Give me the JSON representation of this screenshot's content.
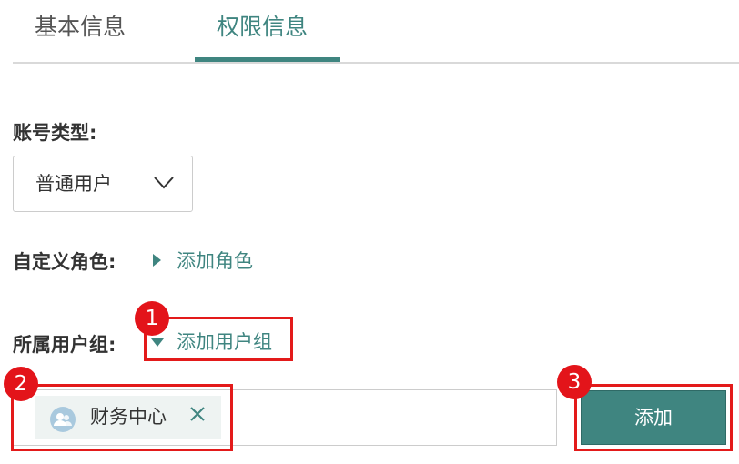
{
  "tabs": [
    {
      "label": "基本信息",
      "active": false
    },
    {
      "label": "权限信息",
      "active": true
    }
  ],
  "account_type": {
    "label": "账号类型:",
    "selected": "普通用户"
  },
  "custom_role": {
    "label": "自定义角色:",
    "link": "添加角色"
  },
  "user_group": {
    "label": "所属用户组:",
    "link": "添加用户组",
    "tags": [
      {
        "label": "财务中心",
        "icon": "user-group-icon"
      }
    ],
    "add_button": "添加"
  },
  "annotations": [
    {
      "number": "1"
    },
    {
      "number": "2"
    },
    {
      "number": "3"
    }
  ],
  "colors": {
    "accent": "#3f8580",
    "annotation": "#e31a1a",
    "tag_bg": "#eef3f2"
  }
}
